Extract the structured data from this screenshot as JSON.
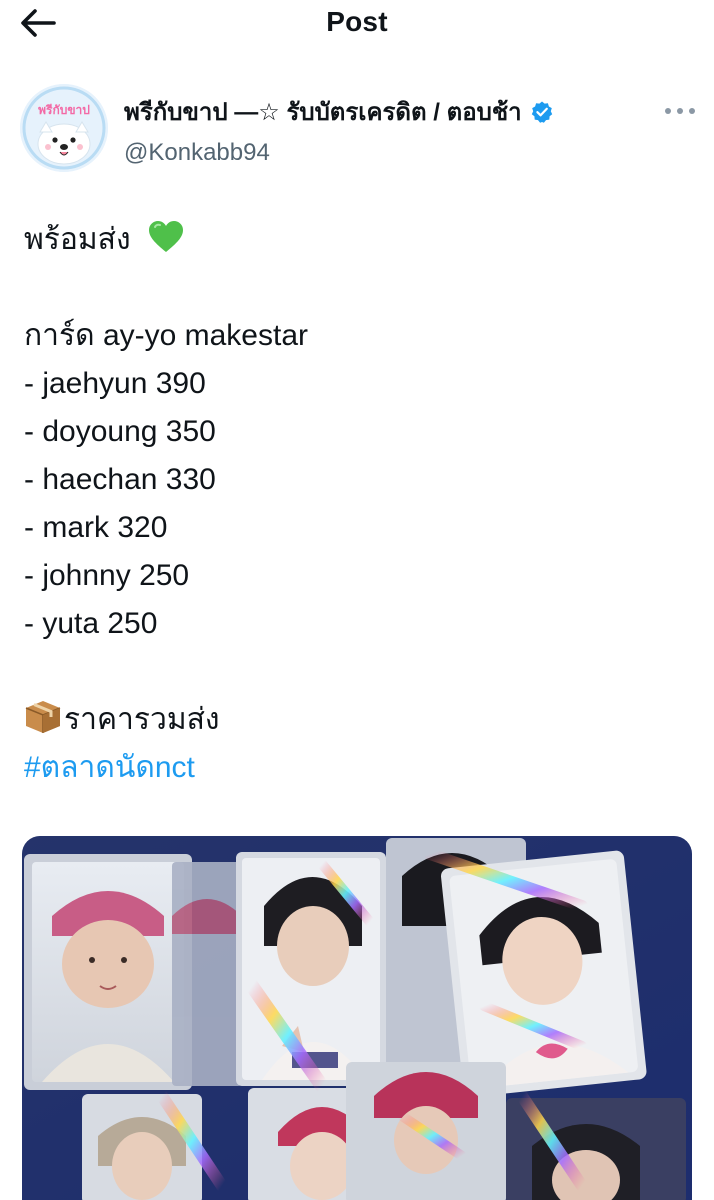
{
  "header": {
    "title": "Post",
    "back_icon": "arrow-left-icon"
  },
  "author": {
    "display_name": "พรีกับขาป —☆ รับบัตรเครดิต / ตอบช้า",
    "handle": "@Konkabb94",
    "avatar_text": "พรีกับขาป",
    "verified_icon": "verified-badge-icon",
    "more_icon": "more-horizontal-icon"
  },
  "post": {
    "intro": "พร้อมส่ง",
    "intro_emoji": "green-heart-icon",
    "list_title": "การ์ด ay-yo makestar",
    "items": [
      "- jaehyun 390",
      "- doyoung 350",
      "- haechan 330",
      "- mark 320",
      "- johnny 250",
      "- yuta 250"
    ],
    "shipping_note": "ราคารวมส่ง",
    "shipping_emoji": "package-icon",
    "hashtag": "#ตลาดนัดnct"
  },
  "media": {
    "description_icon": "photocards-photo"
  },
  "colors": {
    "link": "#1d9bf0",
    "secondary_text": "#536471",
    "verified": "#1d9bf0"
  }
}
